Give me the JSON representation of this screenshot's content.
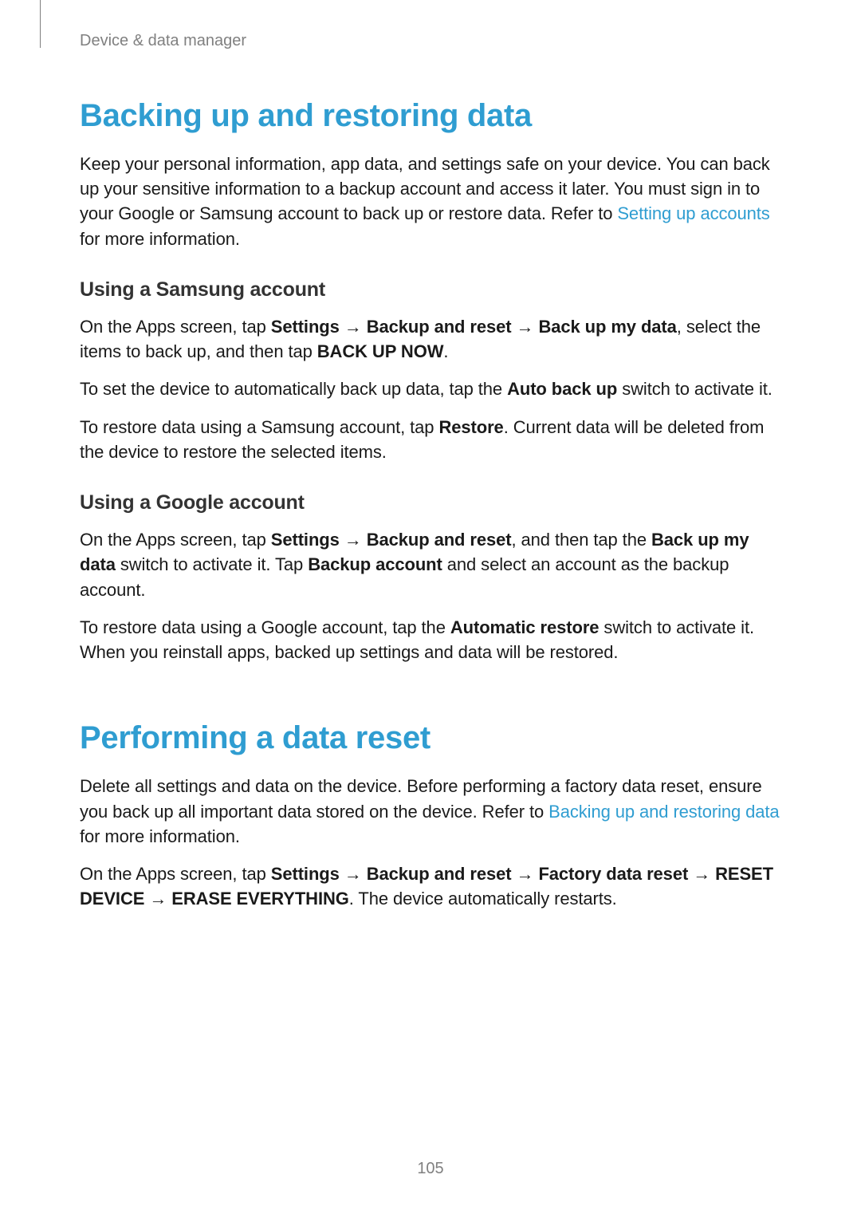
{
  "header": {
    "section": "Device & data manager"
  },
  "section1": {
    "title": "Backing up and restoring data",
    "intro_part1": "Keep your personal information, app data, and settings safe on your device. You can back up your sensitive information to a backup account and access it later. You must sign in to your Google or Samsung account to back up or restore data. Refer to ",
    "intro_link": "Setting up accounts",
    "intro_part2": " for more information.",
    "sub1": {
      "title": "Using a Samsung account",
      "p1_1": "On the Apps screen, tap ",
      "p1_b1": "Settings",
      "p1_arr1": " → ",
      "p1_b2": "Backup and reset",
      "p1_arr2": " → ",
      "p1_b3": "Back up my data",
      "p1_2": ", select the items to back up, and then tap ",
      "p1_b4": "BACK UP NOW",
      "p1_3": ".",
      "p2_1": "To set the device to automatically back up data, tap the ",
      "p2_b1": "Auto back up",
      "p2_2": " switch to activate it.",
      "p3_1": "To restore data using a Samsung account, tap ",
      "p3_b1": "Restore",
      "p3_2": ". Current data will be deleted from the device to restore the selected items."
    },
    "sub2": {
      "title": "Using a Google account",
      "p1_1": "On the Apps screen, tap ",
      "p1_b1": "Settings",
      "p1_arr1": " → ",
      "p1_b2": "Backup and reset",
      "p1_2": ", and then tap the ",
      "p1_b3": "Back up my data",
      "p1_3": " switch to activate it. Tap ",
      "p1_b4": "Backup account",
      "p1_4": " and select an account as the backup account.",
      "p2_1": "To restore data using a Google account, tap the ",
      "p2_b1": "Automatic restore",
      "p2_2": " switch to activate it. When you reinstall apps, backed up settings and data will be restored."
    }
  },
  "section2": {
    "title": "Performing a data reset",
    "p1_1": "Delete all settings and data on the device. Before performing a factory data reset, ensure you back up all important data stored on the device. Refer to ",
    "p1_link": "Backing up and restoring data",
    "p1_2": " for more information.",
    "p2_1": "On the Apps screen, tap ",
    "p2_b1": "Settings",
    "p2_arr1": " → ",
    "p2_b2": "Backup and reset",
    "p2_arr2": " → ",
    "p2_b3": "Factory data reset",
    "p2_arr3": " → ",
    "p2_b4": "RESET DEVICE",
    "p2_arr4": " → ",
    "p2_b5": "ERASE EVERYTHING",
    "p2_2": ". The device automatically restarts."
  },
  "page_number": "105"
}
